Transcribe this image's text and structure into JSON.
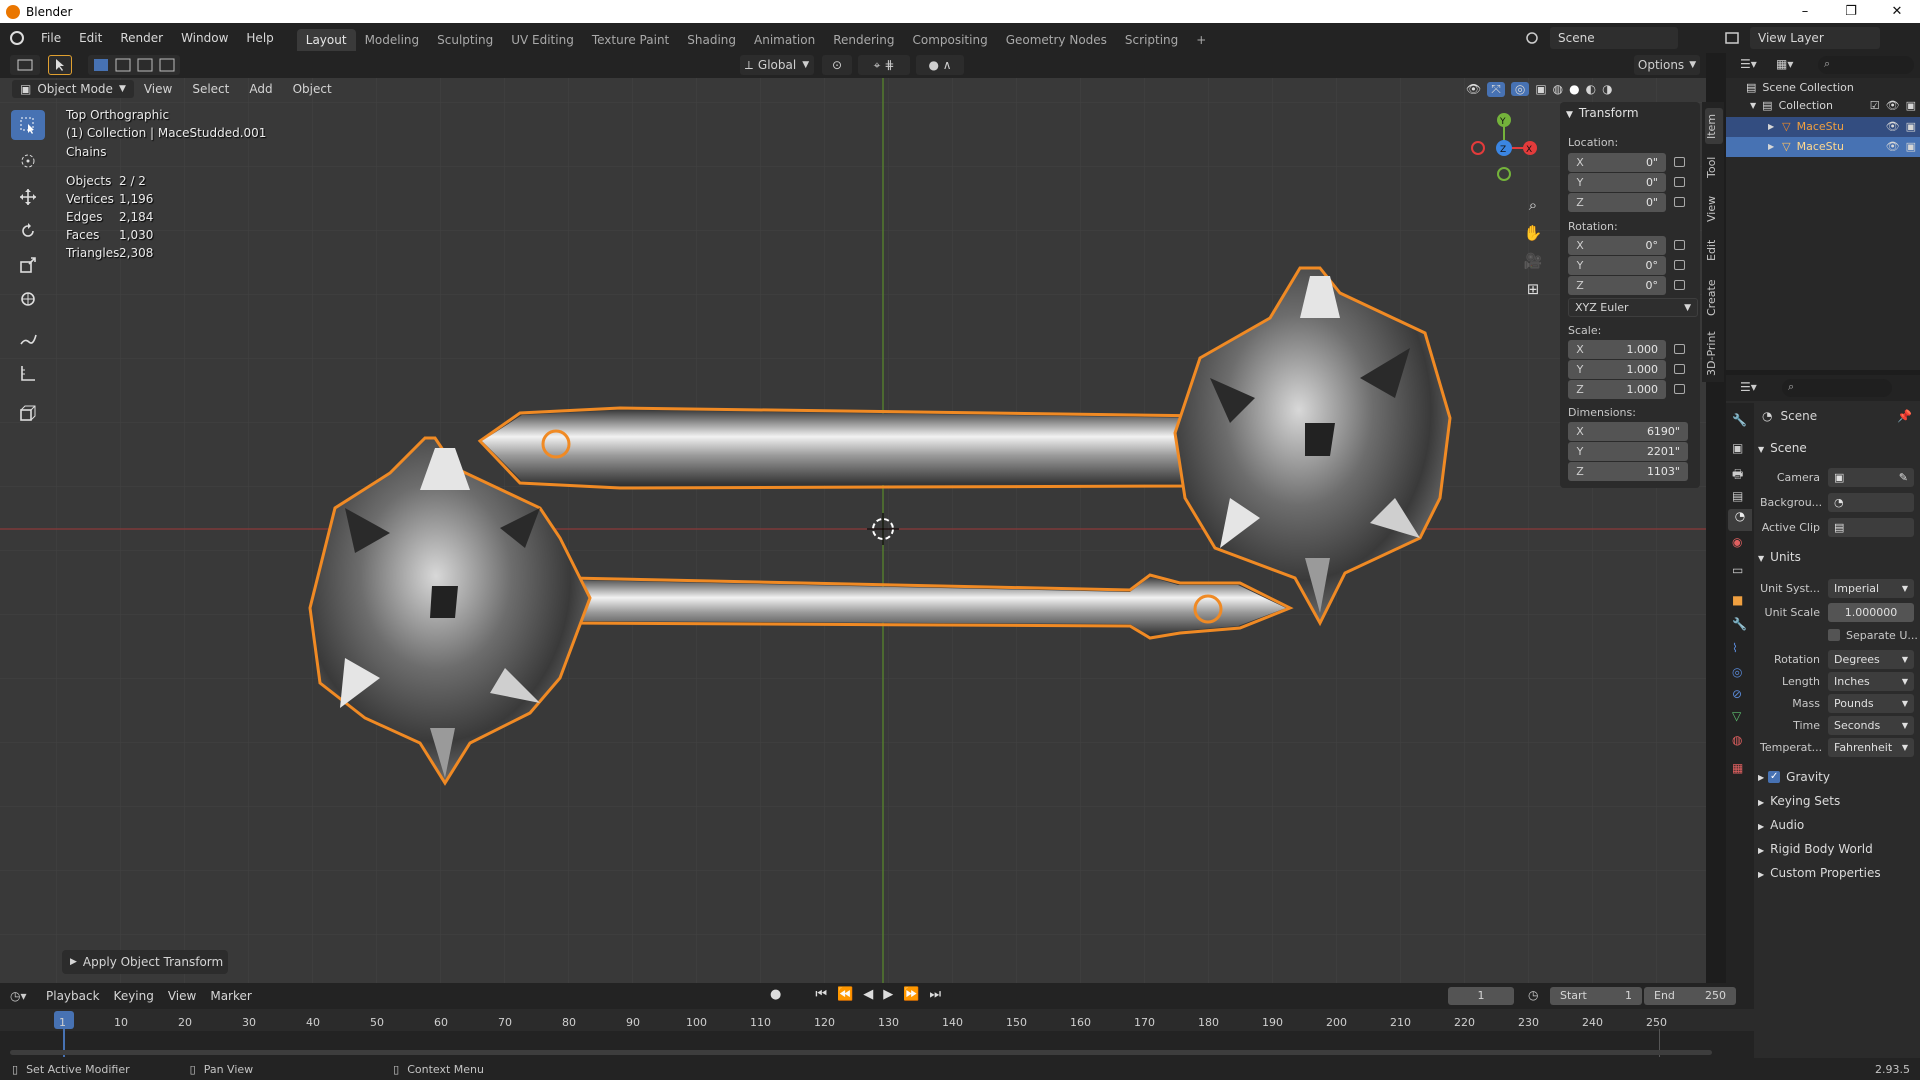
{
  "app": {
    "title": "Blender",
    "version": "2.93.5"
  },
  "window_controls": {
    "minimize": "–",
    "restore": "❐",
    "close": "✕"
  },
  "menu": [
    "File",
    "Edit",
    "Render",
    "Window",
    "Help"
  ],
  "workspaces": [
    "Layout",
    "Modeling",
    "Sculpting",
    "UV Editing",
    "Texture Paint",
    "Shading",
    "Animation",
    "Rendering",
    "Compositing",
    "Geometry Nodes",
    "Scripting"
  ],
  "workspace_add": "+",
  "scene_selector": "Scene",
  "view_layer": "View Layer",
  "header": {
    "transform_orientation": "Global",
    "options": "Options"
  },
  "viewport_header": {
    "mode": "Object Mode",
    "items": [
      "View",
      "Select",
      "Add",
      "Object"
    ]
  },
  "viewport_info": {
    "view_name": "Top Orthographic",
    "collection_line": "(1) Collection | MaceStudded.001",
    "object_name": "Chains",
    "stats": [
      {
        "label": "Objects",
        "value": "2 / 2"
      },
      {
        "label": "Vertices",
        "value": "1,196"
      },
      {
        "label": "Edges",
        "value": "2,184"
      },
      {
        "label": "Faces",
        "value": "1,030"
      },
      {
        "label": "Triangles",
        "value": "2,308"
      }
    ]
  },
  "gizmo": {
    "x": "X",
    "y": "Y",
    "z": "Z"
  },
  "last_operator": "Apply Object Transform",
  "npanel": {
    "header": "Transform",
    "location_label": "Location:",
    "location": [
      {
        "axis": "X",
        "value": "0\""
      },
      {
        "axis": "Y",
        "value": "0\""
      },
      {
        "axis": "Z",
        "value": "0\""
      }
    ],
    "rotation_label": "Rotation:",
    "rotation": [
      {
        "axis": "X",
        "value": "0°"
      },
      {
        "axis": "Y",
        "value": "0°"
      },
      {
        "axis": "Z",
        "value": "0°"
      }
    ],
    "rotation_mode": "XYZ Euler",
    "scale_label": "Scale:",
    "scale": [
      {
        "axis": "X",
        "value": "1.000"
      },
      {
        "axis": "Y",
        "value": "1.000"
      },
      {
        "axis": "Z",
        "value": "1.000"
      }
    ],
    "dimensions_label": "Dimensions:",
    "dimensions": [
      {
        "axis": "X",
        "value": "6190\""
      },
      {
        "axis": "Y",
        "value": "2201\""
      },
      {
        "axis": "Z",
        "value": "1103\""
      }
    ],
    "tabs": [
      "Item",
      "Tool",
      "View",
      "Edit",
      "Create",
      "3D-Print"
    ]
  },
  "outliner": {
    "root": "Scene Collection",
    "collection": "Collection",
    "objects": [
      "MaceStu",
      "MaceStu"
    ]
  },
  "properties": {
    "breadcrumb": "Scene",
    "section_scene": "Scene",
    "camera_label": "Camera",
    "background_label": "Backgrou...",
    "active_clip_label": "Active Clip",
    "section_units": "Units",
    "unit_system_label": "Unit Syst...",
    "unit_system": "Imperial",
    "unit_scale_label": "Unit Scale",
    "unit_scale": "1.000000",
    "separate_units": "Separate U...",
    "rotation_label": "Rotation",
    "rotation": "Degrees",
    "length_label": "Length",
    "length": "Inches",
    "mass_label": "Mass",
    "mass": "Pounds",
    "time_label": "Time",
    "time": "Seconds",
    "temperature_label": "Temperat...",
    "temperature": "Fahrenheit",
    "panels": [
      "Gravity",
      "Keying Sets",
      "Audio",
      "Rigid Body World",
      "Custom Properties"
    ],
    "gravity_checked": true
  },
  "timeline": {
    "menu": [
      "Playback",
      "Keying",
      "View",
      "Marker"
    ],
    "current_frame": "1",
    "start_label": "Start",
    "start": "1",
    "end_label": "End",
    "end": "250",
    "ticks": [
      "1",
      "10",
      "20",
      "30",
      "40",
      "50",
      "60",
      "70",
      "80",
      "90",
      "100",
      "110",
      "120",
      "130",
      "140",
      "150",
      "160",
      "170",
      "180",
      "190",
      "200",
      "210",
      "220",
      "230",
      "240",
      "250"
    ]
  },
  "statusbar": {
    "left": "Set Active Modifier",
    "middle": "Pan View",
    "right": "Context Menu"
  },
  "colors": {
    "accent_blue": "#4772b3",
    "selection_orange": "#f08a24",
    "axis_red": "#e33b3b",
    "axis_green": "#74b33b",
    "axis_blue": "#3b86e3"
  }
}
